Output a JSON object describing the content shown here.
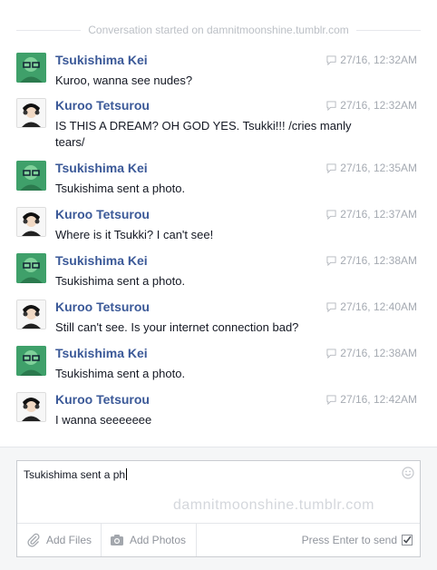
{
  "header": {
    "text": "Conversation started on damnitmoonshine.tumblr.com"
  },
  "messages": [
    {
      "sender": "Tsukishima Kei",
      "time": "27/16, 12:32AM",
      "text": "Kuroo, wanna see nudes?"
    },
    {
      "sender": "Kuroo Tetsurou",
      "time": "27/16, 12:32AM",
      "text": "IS THIS A DREAM? OH GOD YES. Tsukki!!! /cries manly tears/"
    },
    {
      "sender": "Tsukishima Kei",
      "time": "27/16, 12:35AM",
      "text": "Tsukishima sent a photo."
    },
    {
      "sender": "Kuroo Tetsurou",
      "time": "27/16, 12:37AM",
      "text": "Where is it Tsukki? I can't see!"
    },
    {
      "sender": "Tsukishima Kei",
      "time": "27/16, 12:38AM",
      "text": "Tsukishima sent a photo."
    },
    {
      "sender": "Kuroo Tetsurou",
      "time": "27/16, 12:40AM",
      "text": "Still can't see. Is your internet connection bad?"
    },
    {
      "sender": "Tsukishima Kei",
      "time": "27/16, 12:38AM",
      "text": "Tsukishima sent a photo."
    },
    {
      "sender": "Kuroo Tetsurou",
      "time": "27/16, 12:42AM",
      "text": "I wanna seeeeeee"
    }
  ],
  "composer": {
    "value": "Tsukishima sent a ph",
    "watermark": "damnitmoonshine.tumblr.com",
    "add_files": "Add Files",
    "add_photos": "Add Photos",
    "send_hint": "Press Enter to send",
    "send_checked": true
  },
  "colors": {
    "name": "#3b5998",
    "text": "#141823",
    "muted": "#a5aab2",
    "tsuki_avatar": "#3fa06a"
  },
  "icons": {
    "time": "speech-bubble-icon",
    "smiley": "smiley-icon",
    "files": "paperclip-icon",
    "photos": "camera-icon",
    "send": "checkbox-icon"
  }
}
